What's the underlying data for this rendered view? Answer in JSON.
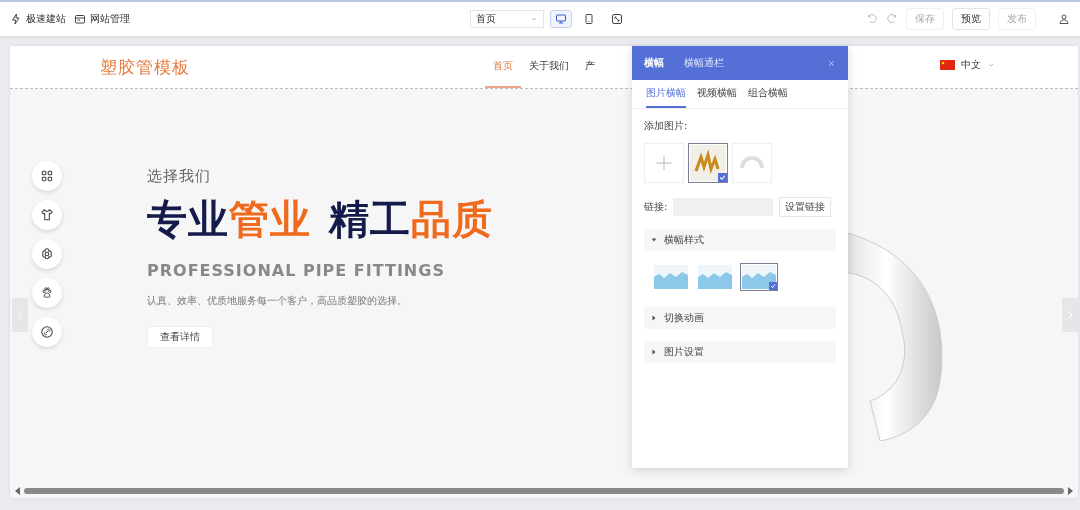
{
  "toolbar": {
    "left_items": [
      {
        "kind": "bolt",
        "label": "极速建站"
      },
      {
        "kind": "calendar",
        "label": "网站管理"
      }
    ],
    "page_select": {
      "value": "首页"
    },
    "devices": [
      {
        "kind": "desktop",
        "selected": true
      },
      {
        "kind": "tablet",
        "selected": false
      },
      {
        "kind": "fit",
        "selected": false
      }
    ],
    "buttons": [
      {
        "label": "保存",
        "disabled": true
      },
      {
        "label": "预览",
        "disabled": false
      },
      {
        "label": "发布",
        "disabled": true
      }
    ]
  },
  "site": {
    "logo": "塑胶管模板",
    "nav": [
      {
        "label": "首页",
        "selected": true
      },
      {
        "label": "关于我们",
        "selected": false
      },
      {
        "label": "产",
        "selected": false
      }
    ],
    "language": "中文",
    "hero": {
      "eyebrow": "选择我们",
      "headline": [
        {
          "text": "专业",
          "color": "#141a4a"
        },
        {
          "text": "管业",
          "color": "#f06a1d"
        },
        {
          "text": "精工",
          "color": "#141a4a"
        },
        {
          "text": "品质",
          "color": "#f06a1d"
        }
      ],
      "subtitle": "PROFESSIONAL PIPE FITTINGS",
      "description": "认真、效率、优质地服务每一个客户，高品质塑胶的选择。",
      "button": "查看详情"
    },
    "side_tools": [
      {
        "kind": "grid"
      },
      {
        "kind": "shirt"
      },
      {
        "kind": "flower"
      },
      {
        "kind": "paw"
      },
      {
        "kind": "link"
      }
    ]
  },
  "panel": {
    "tabs": [
      {
        "label": "横幅",
        "selected": true
      },
      {
        "label": "横幅通栏",
        "selected": false
      }
    ],
    "subtabs": [
      {
        "label": "图片横幅",
        "selected": true
      },
      {
        "label": "视频横幅",
        "selected": false
      },
      {
        "label": "组合横幅",
        "selected": false
      }
    ],
    "add_image_label": "添加图片:",
    "images": [
      {
        "kind": "add",
        "selected": false
      },
      {
        "kind": "photo",
        "selected": true
      },
      {
        "kind": "faded",
        "selected": false
      }
    ],
    "link_label": "链接:",
    "link_button": "设置链接",
    "sections": [
      {
        "title": "横幅样式",
        "expanded": true,
        "styles": [
          {
            "selected": false
          },
          {
            "selected": false
          },
          {
            "selected": true
          }
        ]
      },
      {
        "title": "切换动画",
        "expanded": false
      },
      {
        "title": "图片设置",
        "expanded": false
      }
    ]
  }
}
